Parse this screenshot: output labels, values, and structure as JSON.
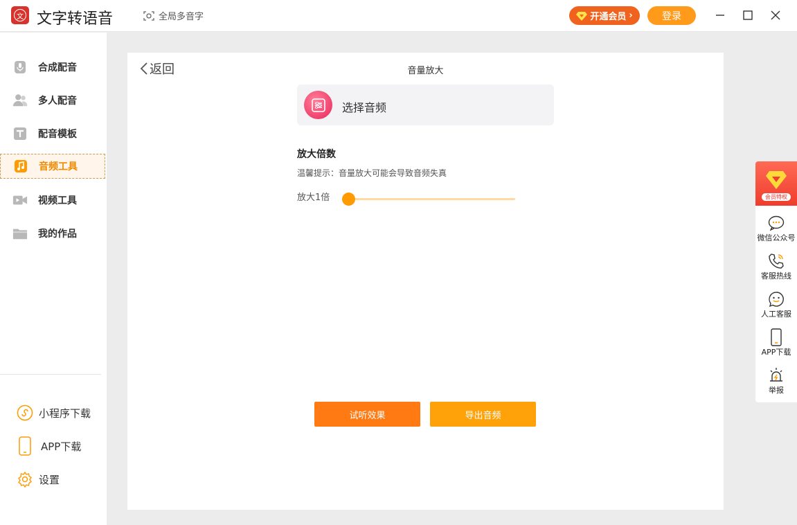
{
  "app": {
    "title": "文字转语音",
    "logo_char": "文",
    "multi_char_label": "全局多音字",
    "vip_label": "开通会员",
    "login_label": "登录"
  },
  "sidebar": {
    "items": [
      {
        "label": "合成配音",
        "icon": "microphone-icon"
      },
      {
        "label": "多人配音",
        "icon": "users-icon"
      },
      {
        "label": "配音模板",
        "icon": "text-template-icon"
      },
      {
        "label": "音频工具",
        "icon": "music-note-icon",
        "active": true
      },
      {
        "label": "视频工具",
        "icon": "video-camera-icon"
      },
      {
        "label": "我的作品",
        "icon": "folder-icon"
      }
    ],
    "bottom": [
      {
        "label": "小程序下载",
        "icon": "mini-program-icon"
      },
      {
        "label": "APP下载",
        "icon": "phone-icon"
      },
      {
        "label": "设置",
        "icon": "gear-icon"
      }
    ]
  },
  "main": {
    "back_label": "返回",
    "title": "音量放大",
    "select_audio_label": "选择音频",
    "factor_title": "放大倍数",
    "hint": "温馨提示：音量放大可能会导致音频失真",
    "slider_label": "放大1倍",
    "slider_value": 0,
    "preview_label": "试听效果",
    "export_label": "导出音频"
  },
  "float_bar": {
    "promo_label": "会员特权",
    "items": [
      {
        "label": "微信公众号",
        "icon": "wechat-chat-icon"
      },
      {
        "label": "客服热线",
        "icon": "phone-call-icon"
      },
      {
        "label": "人工客服",
        "icon": "smile-chat-icon"
      },
      {
        "label": "APP下载",
        "icon": "mobile-icon"
      },
      {
        "label": "举报",
        "icon": "alarm-icon"
      }
    ]
  },
  "colors": {
    "accent": "#ff9a00",
    "vip": "#f0631e",
    "active_text": "#f08a00"
  }
}
